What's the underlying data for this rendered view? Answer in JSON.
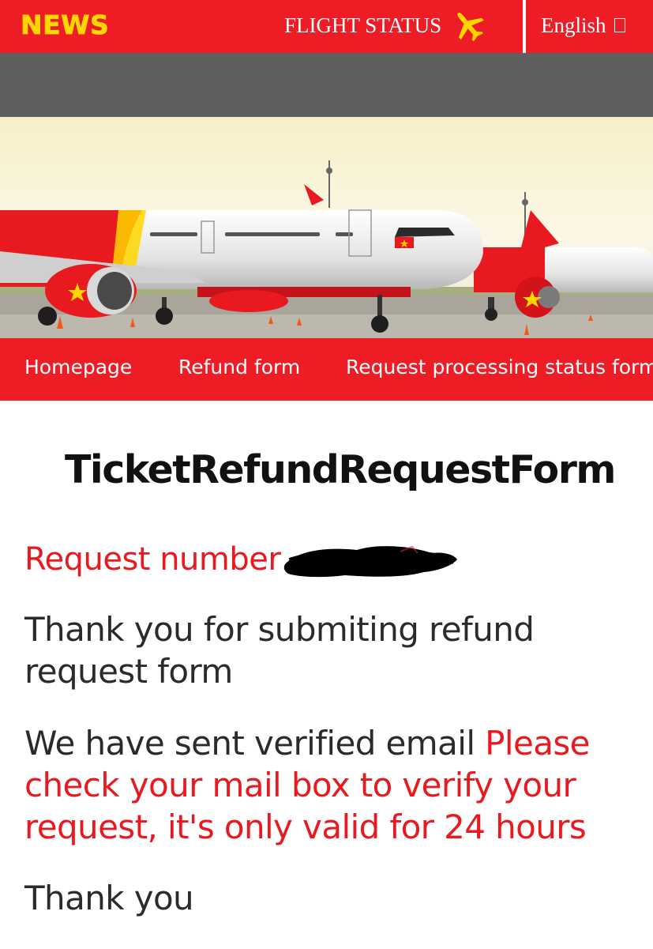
{
  "header": {
    "logo_text": "NEWS",
    "flight_status_label": "FLIGHT STATUS",
    "flight_status_icon": "airplane-icon",
    "language_label": "English",
    "language_icon": "checkbox-glyph-icon"
  },
  "nav": {
    "items": [
      {
        "label": "Homepage"
      },
      {
        "label": "Refund form"
      },
      {
        "label": "Request processing status form"
      }
    ]
  },
  "content": {
    "title": "TicketRefundRequestForm",
    "request_number_label": "Request number",
    "thanks_message": "Thank you for submiting refund request form",
    "email_message_prefix": "We have sent verified email",
    "email_message_highlight": "Please check your mail box to verify your request, it's only valid for 24 hours",
    "closing": "Thank you"
  },
  "colors": {
    "brand_red": "#ee1c25",
    "accent_yellow": "#ffd600",
    "alert_text_red": "#e8191f",
    "body_text": "#2b2b2b",
    "grey_band": "#5f5f5f"
  }
}
